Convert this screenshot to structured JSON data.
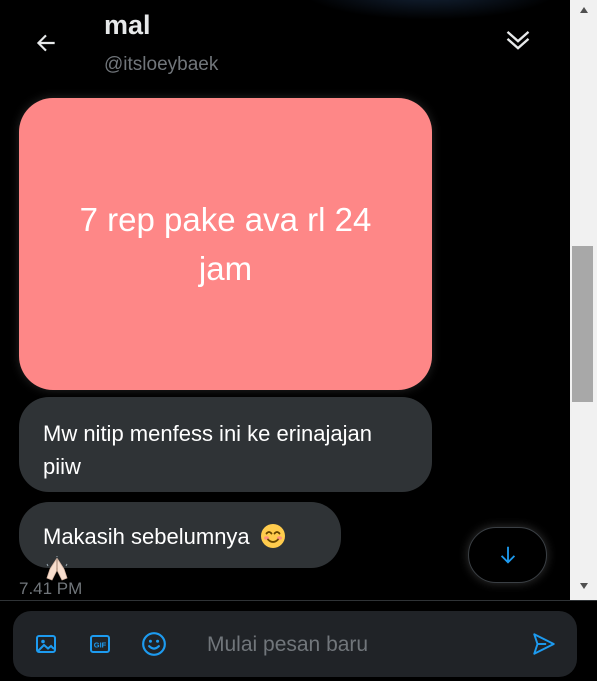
{
  "header": {
    "title": "mal",
    "handle": "@itsloeybaek"
  },
  "messages": [
    {
      "type": "image",
      "text": "7 rep pake ava rl 24 jam",
      "color": "#fe8787"
    },
    {
      "type": "text",
      "text": "Mw nitip menfess ini ke erinajajan piiw"
    },
    {
      "type": "text",
      "text": "Makasih sebelumnya",
      "emojis": [
        "smiling-face-icon",
        "folded-hands-icon"
      ]
    }
  ],
  "timestamp": "7.41 PM",
  "composer": {
    "placeholder": "Mulai pesan baru",
    "gif_label": "GIF"
  },
  "colors": {
    "accent": "#1d9bf0",
    "bubble": "#2f3336",
    "background": "#000000"
  }
}
